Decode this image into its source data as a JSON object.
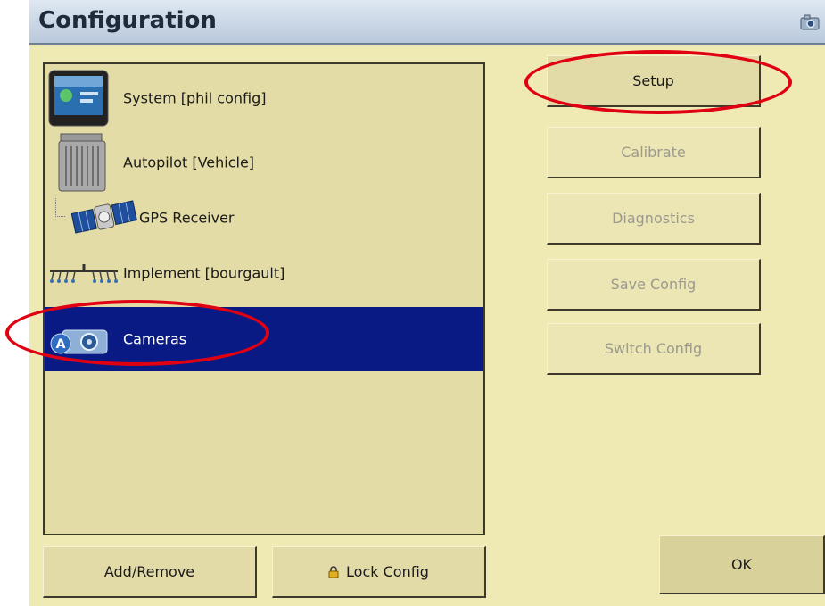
{
  "window": {
    "title": "Configuration"
  },
  "items": [
    {
      "label": "System [phil config]",
      "icon": "display-unit-icon"
    },
    {
      "label": "Autopilot [Vehicle]",
      "icon": "autopilot-controller-icon"
    },
    {
      "label": "GPS Receiver",
      "icon": "satellite-icon"
    },
    {
      "label": "Implement [bourgault]",
      "icon": "implement-icon"
    },
    {
      "label": "Cameras",
      "icon": "camera-icon",
      "selected": true
    }
  ],
  "actions": {
    "setup": "Setup",
    "calibrate": "Calibrate",
    "diagnostics": "Diagnostics",
    "save_config": "Save Config",
    "switch_config": "Switch Config"
  },
  "bottom": {
    "add_remove": "Add/Remove",
    "lock_config": "Lock Config",
    "ok": "OK"
  },
  "colors": {
    "background": "#efe9b4",
    "selection": "#0a1a85",
    "highlight_annotation": "#e00012"
  }
}
